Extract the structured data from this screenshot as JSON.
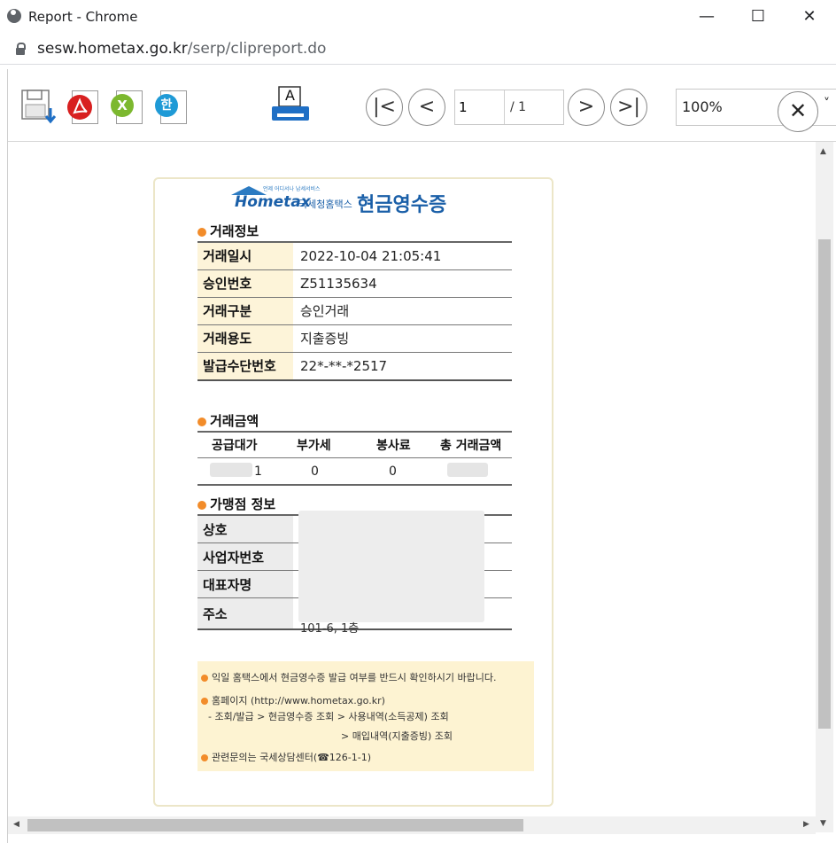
{
  "window": {
    "title": "Report - Chrome",
    "controls": {
      "minimize": "—",
      "maximize": "☐",
      "close": "✕"
    }
  },
  "address": {
    "domain": "sesw.hometax.go.kr",
    "path": "/serp/clipreport.do"
  },
  "toolbar": {
    "hwp_icon_glyph": "한",
    "excel_icon_glyph": "X",
    "print_icon_glyph": "A",
    "first_glyph": "|<",
    "prev_glyph": "<",
    "next_glyph": ">",
    "last_glyph": ">|",
    "page_value": "1",
    "page_total": "/ 1",
    "zoom_value": "100%",
    "zoom_close_glyph": "✕",
    "zoom_dropdown_glyph": "˅"
  },
  "receipt": {
    "logo": {
      "brand": "Hometax",
      "tiny": "언제 어디서나 납세서비스",
      "agency": "국세청홈택스",
      "title": "현금영수증"
    },
    "section_info": {
      "title": "거래정보",
      "rows": [
        {
          "label": "거래일시",
          "value": "2022-10-04 21:05:41"
        },
        {
          "label": "승인번호",
          "value": "Z51135634"
        },
        {
          "label": "거래구분",
          "value": "승인거래"
        },
        {
          "label": "거래용도",
          "value": "지출증빙"
        },
        {
          "label": "발급수단번호",
          "value": "22*-**-*2517"
        }
      ]
    },
    "section_amount": {
      "title": "거래금액",
      "headers": [
        "공급대가",
        "부가세",
        "봉사료",
        "총 거래금액"
      ],
      "values": [
        "1",
        "0",
        "0",
        ""
      ]
    },
    "section_merchant": {
      "title": "가맹점 정보",
      "labels": [
        "상호",
        "사업자번호",
        "대표자명",
        "주소"
      ],
      "address_tail": "101-6, 1층"
    },
    "notice": {
      "line1": "익일 홈택스에서 현금영수증 발급 여부를 반드시 확인하시기 바랍니다.",
      "line2": "홈페이지 (http://www.hometax.go.kr)",
      "line3": "- 조회/발급 > 현금영수증 조회 > 사용내역(소득공제) 조회",
      "line4": "> 매입내역(지출증빙) 조회",
      "line5": "관련문의는 국세상담센터(☎126-1-1)"
    }
  },
  "scroll": {
    "up": "▲",
    "down": "▼",
    "left": "◀",
    "right": "▶"
  }
}
